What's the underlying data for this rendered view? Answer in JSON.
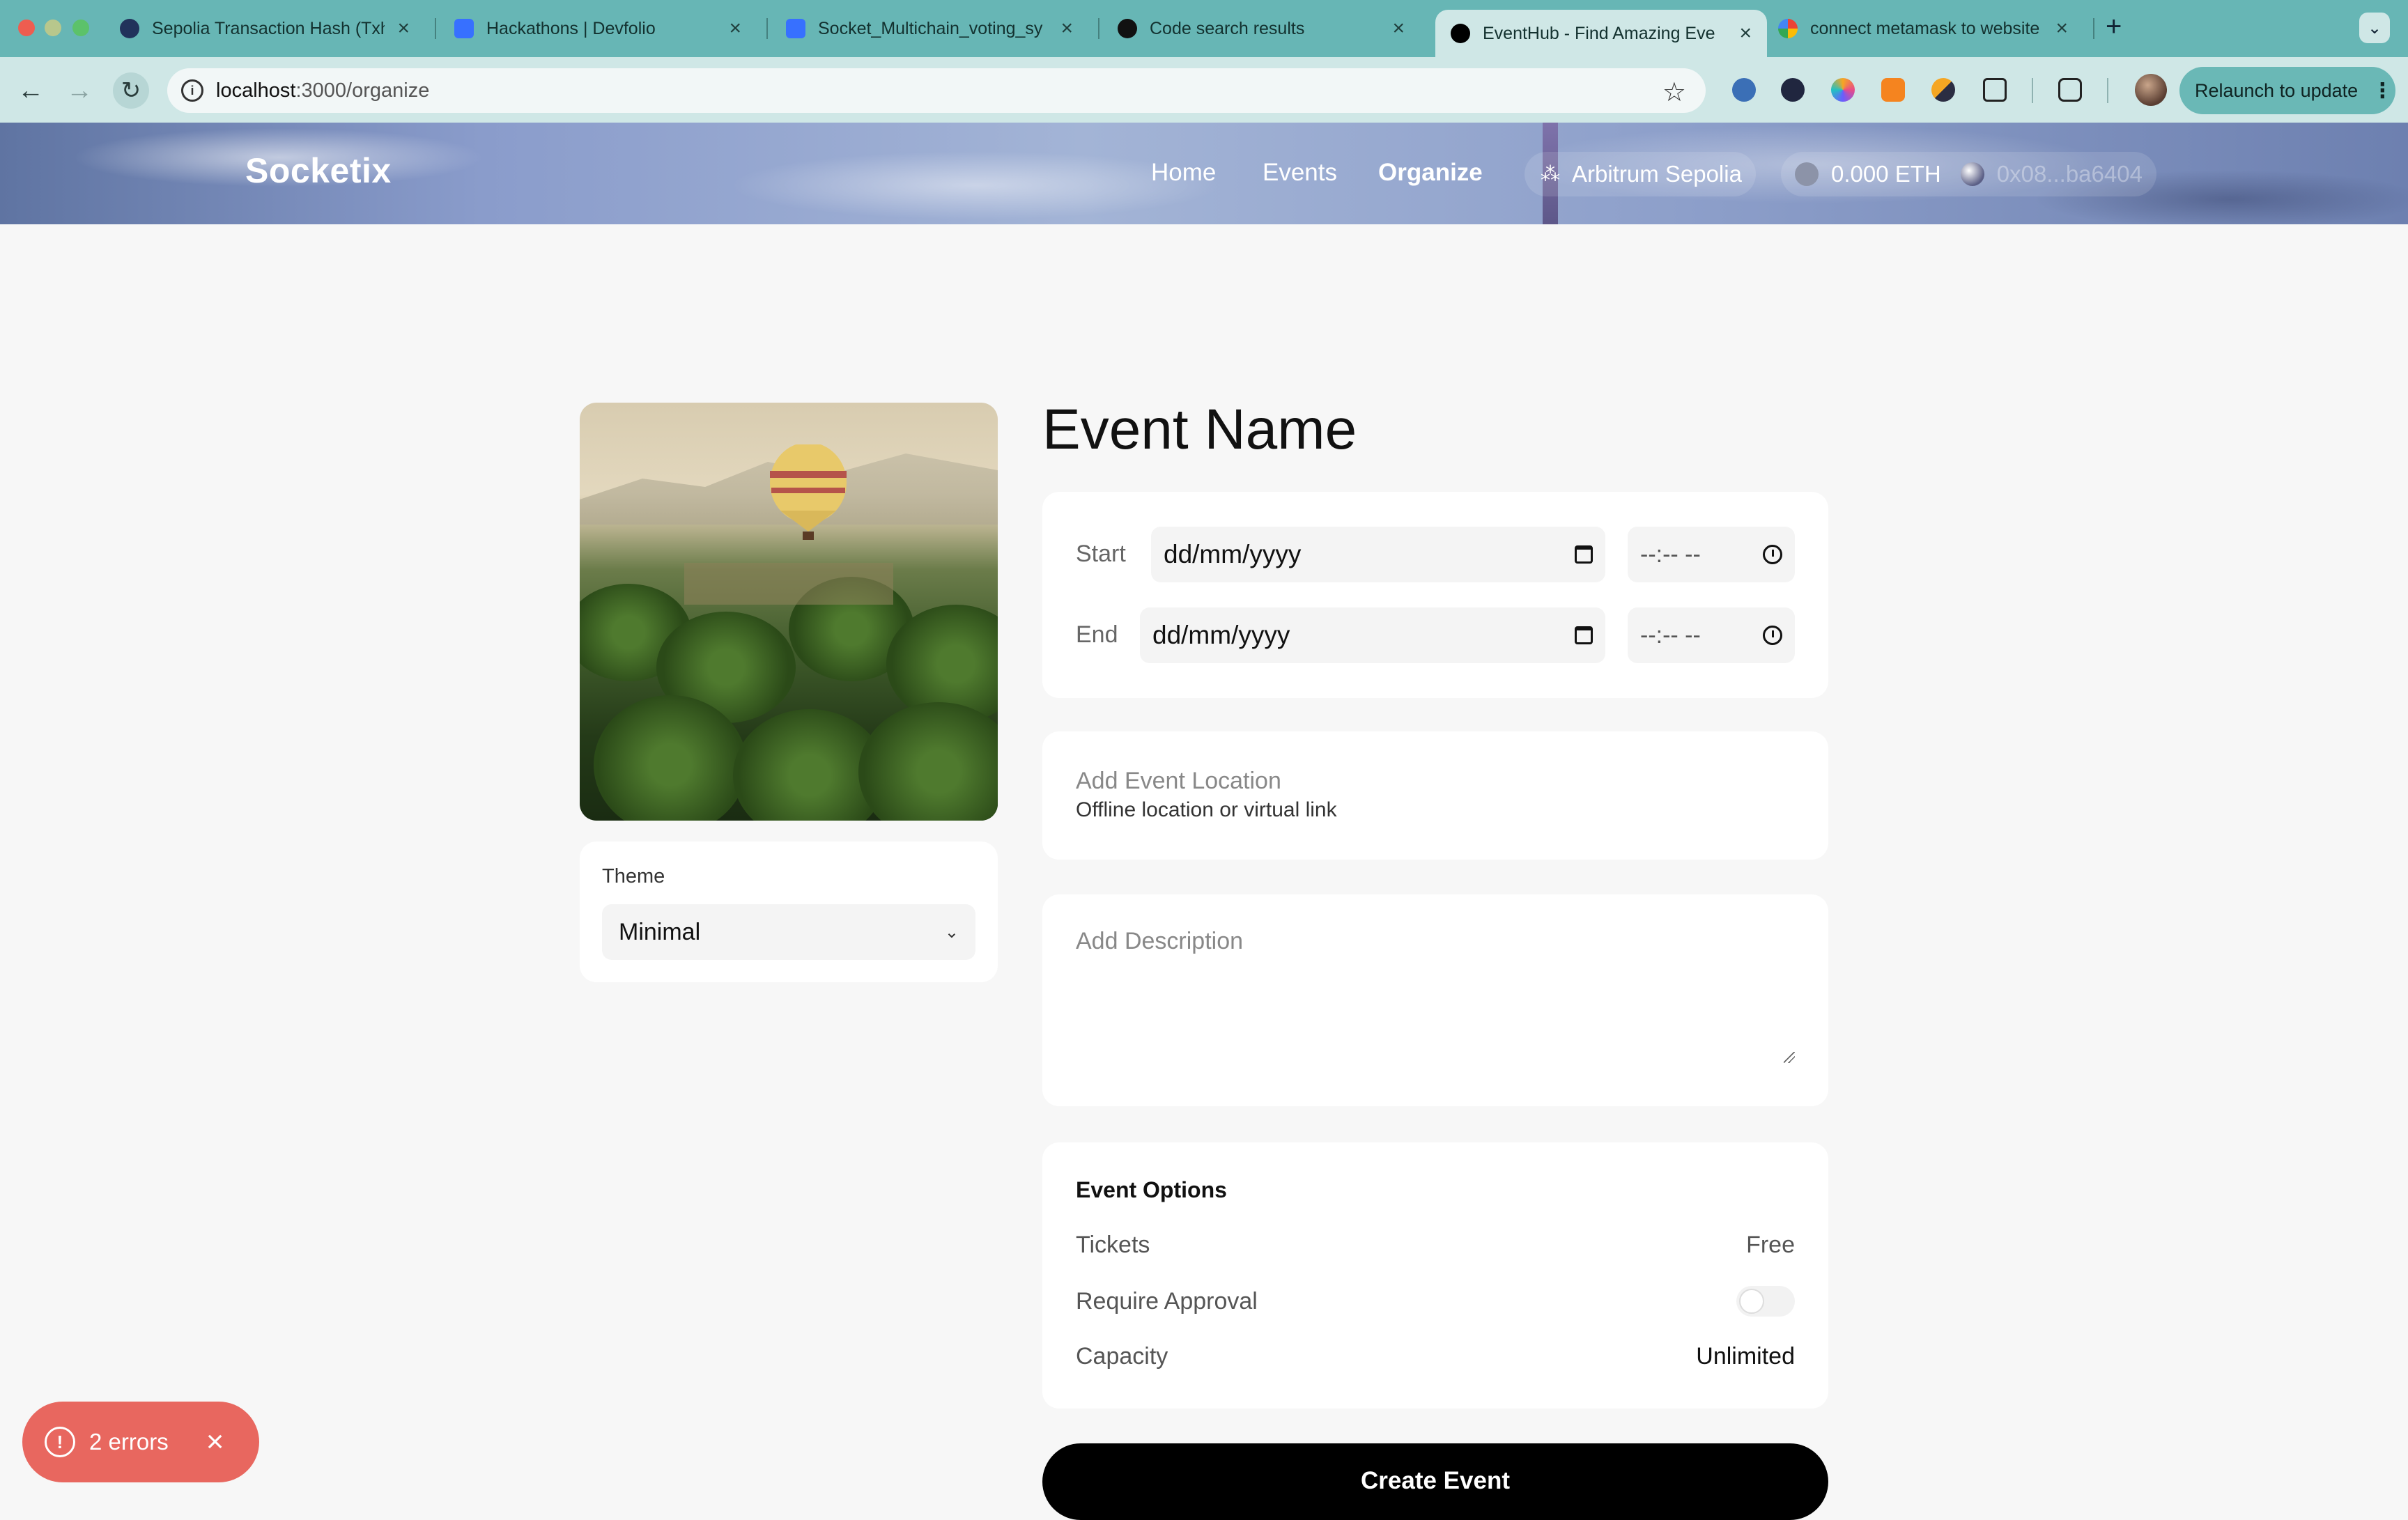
{
  "browser": {
    "tabs": [
      {
        "title": "Sepolia Transaction Hash (Txh",
        "favicon": "etherscan-icon",
        "color": "#21325b"
      },
      {
        "title": "Hackathons | Devfolio",
        "favicon": "devfolio-icon",
        "color": "#3770ff"
      },
      {
        "title": "Socket_Multichain_voting_sy",
        "favicon": "devfolio-icon",
        "color": "#3770ff"
      },
      {
        "title": "Code search results",
        "favicon": "github-icon",
        "color": "#111111"
      },
      {
        "title": "EventHub - Find Amazing Eve",
        "favicon": "eventhub-icon",
        "color": "#000000",
        "active": true
      },
      {
        "title": "connect metamask to website",
        "favicon": "google-icon",
        "color": "#4285f4"
      }
    ],
    "new_tab": "+",
    "url_host": "localhost",
    "url_path": ":3000/organize",
    "relaunch_label": "Relaunch to update"
  },
  "site": {
    "logo": "Socketix",
    "nav": [
      "Home",
      "Events",
      "Organize"
    ],
    "active_nav": "Organize",
    "network": "Arbitrum Sepolia",
    "balance": "0.000 ETH",
    "address": "0x08...ba6404"
  },
  "form": {
    "event_name_placeholder": "Event Name",
    "start_label": "Start",
    "end_label": "End",
    "date_placeholder": "dd/mm/yyyy",
    "time_placeholder": "--:-- --",
    "location_title": "Add Event Location",
    "location_sub": "Offline location or virtual link",
    "description_placeholder": "Add Description",
    "theme_label": "Theme",
    "theme_value": "Minimal",
    "options_title": "Event Options",
    "tickets_label": "Tickets",
    "tickets_value": "Free",
    "approval_label": "Require Approval",
    "approval_enabled": false,
    "capacity_label": "Capacity",
    "capacity_value": "Unlimited",
    "submit_label": "Create Event"
  },
  "errors": {
    "label": "2 errors",
    "color": "#e8675f"
  }
}
